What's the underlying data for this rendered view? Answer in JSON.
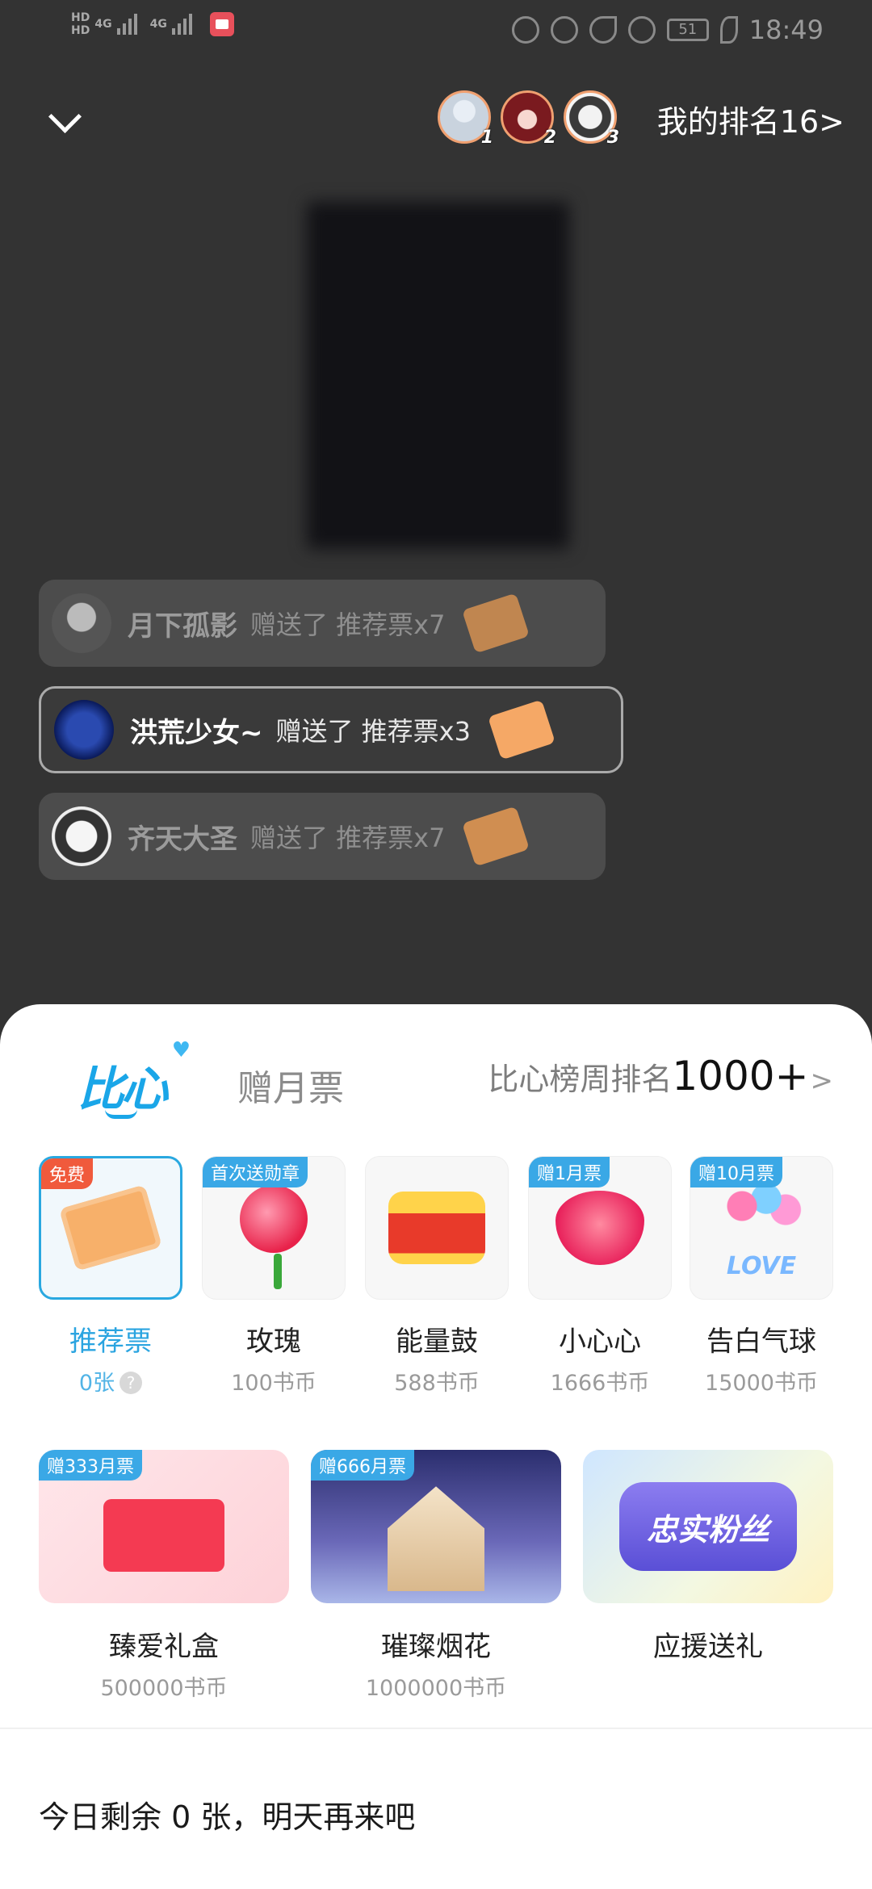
{
  "status_bar": {
    "left": {
      "hd1": "HD",
      "hd2": "HD",
      "net1": "4G",
      "net2": "4G"
    },
    "battery": "51",
    "time": "18:49"
  },
  "header": {
    "collapse_icon": "chevron-down-icon",
    "top_rank_badges": [
      "1",
      "2",
      "3"
    ],
    "my_rank_label": "我的排名16>"
  },
  "messages": [
    {
      "name": "月下孤影",
      "action": "赠送了 推荐票x7",
      "highlighted": false
    },
    {
      "name": "洪荒少女~",
      "action": "赠送了 推荐票x3",
      "highlighted": true
    },
    {
      "name": "齐天大圣",
      "action": "赠送了 推荐票x7",
      "highlighted": false
    }
  ],
  "sheet": {
    "tabs": {
      "active": "比心",
      "inactive": "赠月票"
    },
    "weekly_rank": {
      "label": "比心榜周排名",
      "value": "1000+",
      "chevron": ">"
    },
    "gifts": [
      {
        "tag": "免费",
        "name": "推荐票",
        "price": "0张"
      },
      {
        "tag": "首次送勋章",
        "name": "玫瑰",
        "price": "100书币"
      },
      {
        "tag": "",
        "name": "能量鼓",
        "price": "588书币"
      },
      {
        "tag": "赠1月票",
        "name": "小心心",
        "price": "1666书币"
      },
      {
        "tag": "赠10月票",
        "name": "告白气球",
        "price": "15000书币",
        "art_text": "LOVE"
      }
    ],
    "big_gifts": [
      {
        "tag": "赠333月票",
        "name": "臻爱礼盒",
        "price": "500000书币"
      },
      {
        "tag": "赠666月票",
        "name": "璀璨烟花",
        "price": "1000000书币"
      },
      {
        "tag": "",
        "name": "应援送礼",
        "price": "",
        "badge_text": "忠实粉丝"
      }
    ],
    "remaining_text": "今日剩余 0 张，明天再来吧"
  },
  "colors": {
    "accent": "#29a8e0",
    "tag_red": "#f05a3c",
    "overlay": "#333333"
  }
}
